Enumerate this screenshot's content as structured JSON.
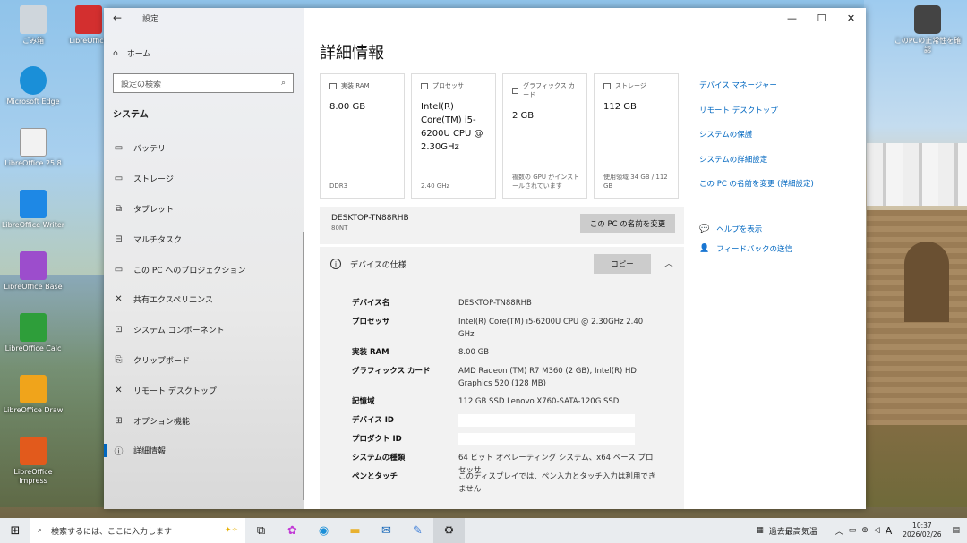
{
  "desktop": {
    "icons": [
      {
        "label": "ごみ箱",
        "color": "#cfd6dc"
      },
      {
        "label": "Microsoft Edge",
        "color": "#1a8fd8"
      },
      {
        "label": "LibreOffice 25.8",
        "color": "#f2f2f2"
      },
      {
        "label": "LibreOffice Writer",
        "color": "#1e88e5"
      },
      {
        "label": "LibreOffice Base",
        "color": "#9c4dcc"
      },
      {
        "label": "LibreOffice Calc",
        "color": "#2e9e3a"
      },
      {
        "label": "LibreOffice Draw",
        "color": "#f0a41b"
      },
      {
        "label": "LibreOffice Impress",
        "color": "#e25a1c"
      }
    ],
    "top_icon": {
      "label": "LibreOffice",
      "color": "#d32f2f"
    },
    "right_icon": {
      "label": "このPCの正常性を確認",
      "color": "#444"
    }
  },
  "settings": {
    "window_title": "設定",
    "home": "ホーム",
    "search_placeholder": "設定の検索",
    "section": "システム",
    "nav": [
      {
        "icon": "battery-icon",
        "glyph": "▭",
        "label": "バッテリー"
      },
      {
        "icon": "storage-icon",
        "glyph": "▭",
        "label": "ストレージ"
      },
      {
        "icon": "tablet-icon",
        "glyph": "⧉",
        "label": "タブレット"
      },
      {
        "icon": "multitask-icon",
        "glyph": "⊟",
        "label": "マルチタスク"
      },
      {
        "icon": "projection-icon",
        "glyph": "▭",
        "label": "この PC へのプロジェクション"
      },
      {
        "icon": "shared-experience-icon",
        "glyph": "✕",
        "label": "共有エクスペリエンス"
      },
      {
        "icon": "components-icon",
        "glyph": "⊡",
        "label": "システム コンポーネント"
      },
      {
        "icon": "clipboard-icon",
        "glyph": "⎘",
        "label": "クリップボード"
      },
      {
        "icon": "remote-desktop-icon",
        "glyph": "✕",
        "label": "リモート デスクトップ"
      },
      {
        "icon": "optional-features-icon",
        "glyph": "⊞",
        "label": "オプション機能"
      },
      {
        "icon": "info-icon",
        "glyph": "ⓘ",
        "label": "詳細情報"
      }
    ],
    "page_title": "詳細情報",
    "cards": [
      {
        "label": "実装 RAM",
        "value": "8.00 GB",
        "foot": "DDR3"
      },
      {
        "label": "プロセッサ",
        "value": "Intel(R) Core(TM) i5-6200U CPU @ 2.30GHz",
        "foot": "2.40 GHz"
      },
      {
        "label": "グラフィックス カード",
        "value": "2 GB",
        "foot": "複数の GPU がインストールされています"
      },
      {
        "label": "ストレージ",
        "value": "112 GB",
        "foot": "使用領域 34 GB / 112 GB"
      }
    ],
    "right_links": [
      "デバイス マネージャー",
      "リモート デスクトップ",
      "システムの保護",
      "システムの詳細設定",
      "この PC の名前を変更 (詳細設定)"
    ],
    "help_links": [
      "ヘルプを表示",
      "フィードバックの送信"
    ],
    "pc_name": "DESKTOP-TN88RHB",
    "pc_model": "80NT",
    "rename_button": "この PC の名前を変更",
    "specs_title": "デバイスの仕様",
    "copy_button": "コピー",
    "specs": [
      {
        "k": "デバイス名",
        "v": "DESKTOP-TN88RHB"
      },
      {
        "k": "プロセッサ",
        "v": "Intel(R) Core(TM) i5-6200U CPU @ 2.30GHz   2.40 GHz"
      },
      {
        "k": "実装 RAM",
        "v": "8.00 GB"
      },
      {
        "k": "グラフィックス カード",
        "v": "AMD Radeon (TM) R7 M360 (2 GB), Intel(R) HD Graphics 520 (128 MB)"
      },
      {
        "k": "記憶域",
        "v": "112 GB SSD Lenovo X760-SATA-120G SSD"
      },
      {
        "k": "デバイス ID",
        "v": ""
      },
      {
        "k": "プロダクト ID",
        "v": ""
      },
      {
        "k": "システムの種類",
        "v": "64 ビット オペレーティング システム、x64 ベース プロセッサ"
      },
      {
        "k": "ペンとタッチ",
        "v": "このディスプレイでは、ペン入力とタッチ入力は利用できません"
      }
    ]
  },
  "taskbar": {
    "search_placeholder": "検索するには、ここに入力します",
    "weather": "過去最高気温",
    "ime": "A",
    "time": "10:37",
    "date": "2026/02/26"
  }
}
